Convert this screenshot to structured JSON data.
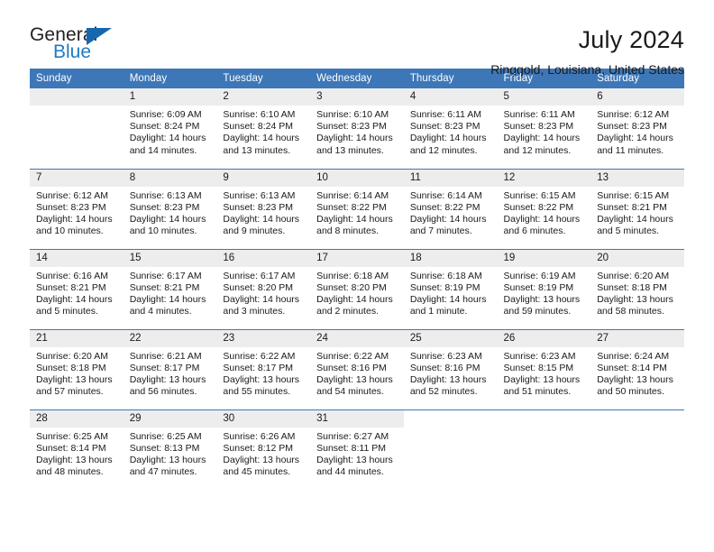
{
  "brand": {
    "name_top": "General",
    "name_bottom": "Blue",
    "triangle_color": "#1667ad",
    "blue_text_color": "#1e7bc4"
  },
  "header": {
    "title": "July 2024",
    "subtitle": "Ringgold, Louisiana, United States"
  },
  "theme": {
    "header_blue": "#3d77b8",
    "daynum_gray": "#ededed",
    "cell_white": "#ffffff",
    "text": "#1a1a1a"
  },
  "weekdays": [
    "Sunday",
    "Monday",
    "Tuesday",
    "Wednesday",
    "Thursday",
    "Friday",
    "Saturday"
  ],
  "labels": {
    "sunrise_prefix": "Sunrise:",
    "sunset_prefix": "Sunset:",
    "daylight_prefix": "Daylight:"
  },
  "weeks": [
    [
      {
        "day": "",
        "empty": true,
        "sunrise": "",
        "sunset": "",
        "daylight": ""
      },
      {
        "day": "1",
        "sunrise": "Sunrise: 6:09 AM",
        "sunset": "Sunset: 8:24 PM",
        "daylight": "Daylight: 14 hours and 14 minutes."
      },
      {
        "day": "2",
        "sunrise": "Sunrise: 6:10 AM",
        "sunset": "Sunset: 8:24 PM",
        "daylight": "Daylight: 14 hours and 13 minutes."
      },
      {
        "day": "3",
        "sunrise": "Sunrise: 6:10 AM",
        "sunset": "Sunset: 8:23 PM",
        "daylight": "Daylight: 14 hours and 13 minutes."
      },
      {
        "day": "4",
        "sunrise": "Sunrise: 6:11 AM",
        "sunset": "Sunset: 8:23 PM",
        "daylight": "Daylight: 14 hours and 12 minutes."
      },
      {
        "day": "5",
        "sunrise": "Sunrise: 6:11 AM",
        "sunset": "Sunset: 8:23 PM",
        "daylight": "Daylight: 14 hours and 12 minutes."
      },
      {
        "day": "6",
        "sunrise": "Sunrise: 6:12 AM",
        "sunset": "Sunset: 8:23 PM",
        "daylight": "Daylight: 14 hours and 11 minutes."
      }
    ],
    [
      {
        "day": "7",
        "sunrise": "Sunrise: 6:12 AM",
        "sunset": "Sunset: 8:23 PM",
        "daylight": "Daylight: 14 hours and 10 minutes."
      },
      {
        "day": "8",
        "sunrise": "Sunrise: 6:13 AM",
        "sunset": "Sunset: 8:23 PM",
        "daylight": "Daylight: 14 hours and 10 minutes."
      },
      {
        "day": "9",
        "sunrise": "Sunrise: 6:13 AM",
        "sunset": "Sunset: 8:23 PM",
        "daylight": "Daylight: 14 hours and 9 minutes."
      },
      {
        "day": "10",
        "sunrise": "Sunrise: 6:14 AM",
        "sunset": "Sunset: 8:22 PM",
        "daylight": "Daylight: 14 hours and 8 minutes."
      },
      {
        "day": "11",
        "sunrise": "Sunrise: 6:14 AM",
        "sunset": "Sunset: 8:22 PM",
        "daylight": "Daylight: 14 hours and 7 minutes."
      },
      {
        "day": "12",
        "sunrise": "Sunrise: 6:15 AM",
        "sunset": "Sunset: 8:22 PM",
        "daylight": "Daylight: 14 hours and 6 minutes."
      },
      {
        "day": "13",
        "sunrise": "Sunrise: 6:15 AM",
        "sunset": "Sunset: 8:21 PM",
        "daylight": "Daylight: 14 hours and 5 minutes."
      }
    ],
    [
      {
        "day": "14",
        "sunrise": "Sunrise: 6:16 AM",
        "sunset": "Sunset: 8:21 PM",
        "daylight": "Daylight: 14 hours and 5 minutes."
      },
      {
        "day": "15",
        "sunrise": "Sunrise: 6:17 AM",
        "sunset": "Sunset: 8:21 PM",
        "daylight": "Daylight: 14 hours and 4 minutes."
      },
      {
        "day": "16",
        "sunrise": "Sunrise: 6:17 AM",
        "sunset": "Sunset: 8:20 PM",
        "daylight": "Daylight: 14 hours and 3 minutes."
      },
      {
        "day": "17",
        "sunrise": "Sunrise: 6:18 AM",
        "sunset": "Sunset: 8:20 PM",
        "daylight": "Daylight: 14 hours and 2 minutes."
      },
      {
        "day": "18",
        "sunrise": "Sunrise: 6:18 AM",
        "sunset": "Sunset: 8:19 PM",
        "daylight": "Daylight: 14 hours and 1 minute."
      },
      {
        "day": "19",
        "sunrise": "Sunrise: 6:19 AM",
        "sunset": "Sunset: 8:19 PM",
        "daylight": "Daylight: 13 hours and 59 minutes."
      },
      {
        "day": "20",
        "sunrise": "Sunrise: 6:20 AM",
        "sunset": "Sunset: 8:18 PM",
        "daylight": "Daylight: 13 hours and 58 minutes."
      }
    ],
    [
      {
        "day": "21",
        "sunrise": "Sunrise: 6:20 AM",
        "sunset": "Sunset: 8:18 PM",
        "daylight": "Daylight: 13 hours and 57 minutes."
      },
      {
        "day": "22",
        "sunrise": "Sunrise: 6:21 AM",
        "sunset": "Sunset: 8:17 PM",
        "daylight": "Daylight: 13 hours and 56 minutes."
      },
      {
        "day": "23",
        "sunrise": "Sunrise: 6:22 AM",
        "sunset": "Sunset: 8:17 PM",
        "daylight": "Daylight: 13 hours and 55 minutes."
      },
      {
        "day": "24",
        "sunrise": "Sunrise: 6:22 AM",
        "sunset": "Sunset: 8:16 PM",
        "daylight": "Daylight: 13 hours and 54 minutes."
      },
      {
        "day": "25",
        "sunrise": "Sunrise: 6:23 AM",
        "sunset": "Sunset: 8:16 PM",
        "daylight": "Daylight: 13 hours and 52 minutes."
      },
      {
        "day": "26",
        "sunrise": "Sunrise: 6:23 AM",
        "sunset": "Sunset: 8:15 PM",
        "daylight": "Daylight: 13 hours and 51 minutes."
      },
      {
        "day": "27",
        "sunrise": "Sunrise: 6:24 AM",
        "sunset": "Sunset: 8:14 PM",
        "daylight": "Daylight: 13 hours and 50 minutes."
      }
    ],
    [
      {
        "day": "28",
        "sunrise": "Sunrise: 6:25 AM",
        "sunset": "Sunset: 8:14 PM",
        "daylight": "Daylight: 13 hours and 48 minutes."
      },
      {
        "day": "29",
        "sunrise": "Sunrise: 6:25 AM",
        "sunset": "Sunset: 8:13 PM",
        "daylight": "Daylight: 13 hours and 47 minutes."
      },
      {
        "day": "30",
        "sunrise": "Sunrise: 6:26 AM",
        "sunset": "Sunset: 8:12 PM",
        "daylight": "Daylight: 13 hours and 45 minutes."
      },
      {
        "day": "31",
        "sunrise": "Sunrise: 6:27 AM",
        "sunset": "Sunset: 8:11 PM",
        "daylight": "Daylight: 13 hours and 44 minutes."
      },
      {
        "day": "",
        "empty": true,
        "trailing": true,
        "sunrise": "",
        "sunset": "",
        "daylight": ""
      },
      {
        "day": "",
        "empty": true,
        "trailing": true,
        "sunrise": "",
        "sunset": "",
        "daylight": ""
      },
      {
        "day": "",
        "empty": true,
        "trailing": true,
        "sunrise": "",
        "sunset": "",
        "daylight": ""
      }
    ]
  ]
}
